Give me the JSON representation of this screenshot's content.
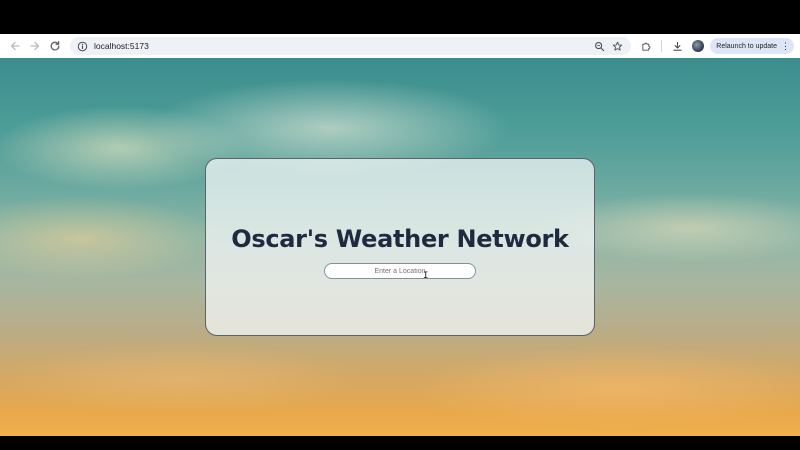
{
  "browser": {
    "url": "localhost:5173",
    "relaunch_label": "Relaunch to update",
    "icons": {
      "back": "arrow-left-icon",
      "forward": "arrow-right-icon",
      "reload": "reload-icon",
      "site_info": "info-icon",
      "zoom": "zoom-icon",
      "bookmark": "star-icon",
      "extensions": "puzzle-icon",
      "downloads": "download-icon",
      "profile": "avatar",
      "menu": "more-vert-icon"
    }
  },
  "app": {
    "title": "Oscar's Weather Network",
    "search": {
      "placeholder": "Enter a Location",
      "value": ""
    }
  }
}
